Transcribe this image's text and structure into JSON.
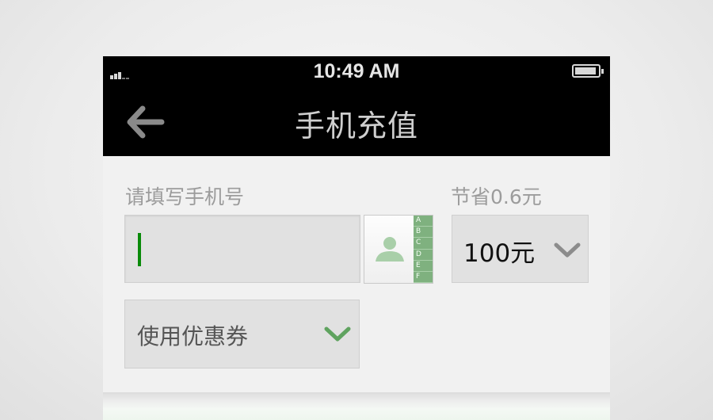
{
  "status_bar": {
    "time": "10:49 AM",
    "signal_icon": "signal-icon",
    "battery_icon": "battery-icon"
  },
  "nav": {
    "back_icon": "back-arrow-icon",
    "title": "手机充值"
  },
  "form": {
    "phone_label": "请填写手机号",
    "phone_value": "",
    "contacts_icon": "contacts-book-icon",
    "contacts_index": [
      "A",
      "B",
      "C",
      "D",
      "E",
      "F"
    ],
    "savings_label": "节省0.6元",
    "amount_value": "100元",
    "coupon_value": "使用优惠券"
  },
  "colors": {
    "bar_background": "#000000",
    "accent_green": "#5fa35f",
    "cursor_green": "#0a8a0a"
  }
}
